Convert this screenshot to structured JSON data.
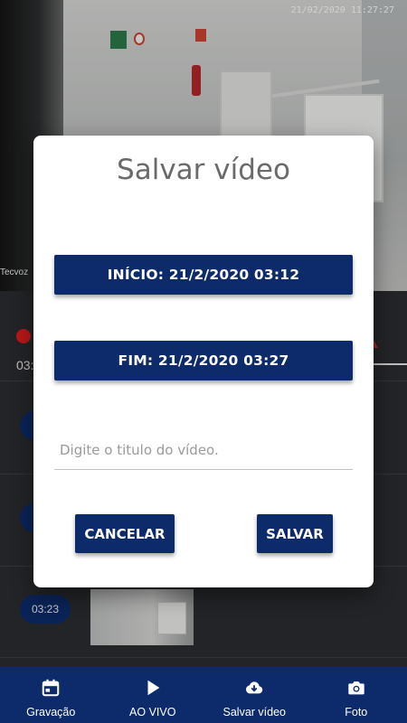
{
  "camera": {
    "timestamp": "21/02/2020 11:27:27",
    "label": "Tecvoz"
  },
  "timeline": {
    "current_time": "03:"
  },
  "clips": [
    {
      "time": "0"
    },
    {
      "time": "0"
    },
    {
      "time": "03:23"
    }
  ],
  "dialog": {
    "title": "Salvar vídeo",
    "start_button": "INÍCIO: 21/2/2020 03:12",
    "end_button": "FIM: 21/2/2020 03:27",
    "title_placeholder": "Digite o titulo do vídeo.",
    "title_value": "",
    "cancel_label": "CANCELAR",
    "save_label": "SALVAR"
  },
  "bottom_nav": {
    "items": [
      {
        "label": "Gravação",
        "icon": "calendar-icon"
      },
      {
        "label": "AO VIVO",
        "icon": "play-icon"
      },
      {
        "label": "Salvar vídeo",
        "icon": "cloud-download-icon"
      },
      {
        "label": "Foto",
        "icon": "camera-icon"
      }
    ]
  },
  "colors": {
    "primary": "#0d2b6b",
    "recording": "#e21d1d",
    "background": "#2b2c30"
  }
}
